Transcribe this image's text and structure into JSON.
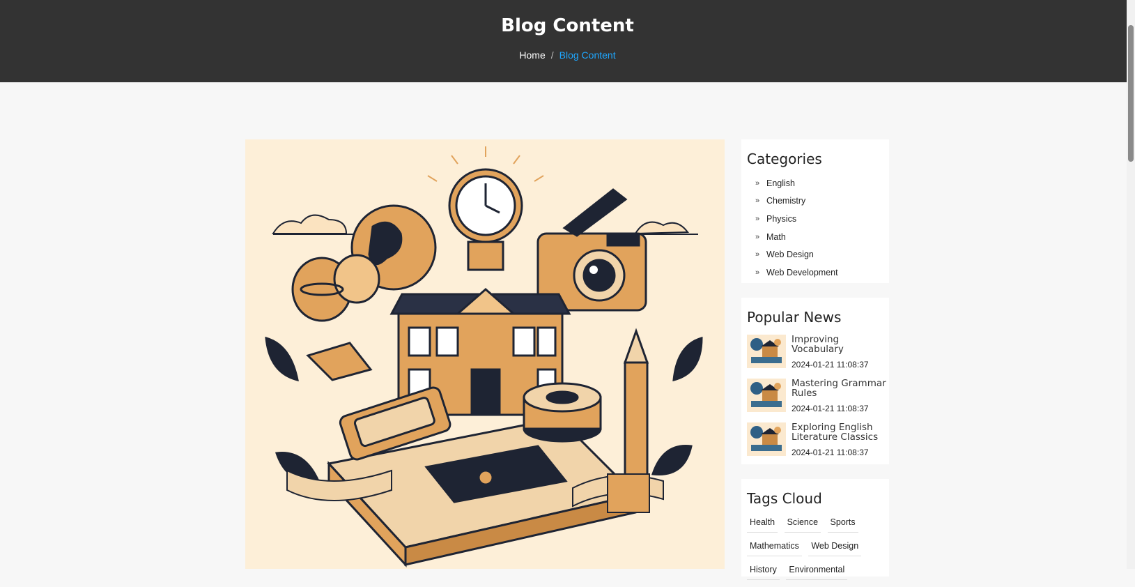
{
  "header": {
    "title": "Blog Content",
    "breadcrumb": {
      "home": "Home",
      "separator": "/",
      "current": "Blog Content"
    }
  },
  "feature_image": {
    "icon": "education-collage-illustration"
  },
  "sidebar": {
    "categories": {
      "title": "Categories",
      "items": [
        {
          "label": "English"
        },
        {
          "label": "Chemistry"
        },
        {
          "label": "Physics"
        },
        {
          "label": "Math"
        },
        {
          "label": "Web Design"
        },
        {
          "label": "Web Development"
        }
      ]
    },
    "popular_news": {
      "title": "Popular News",
      "items": [
        {
          "title": "Improving Vocabulary",
          "date": "2024-01-21 11:08:37"
        },
        {
          "title": "Mastering Grammar Rules",
          "date": "2024-01-21 11:08:37"
        },
        {
          "title": "Exploring English Literature Classics",
          "date": "2024-01-21 11:08:37"
        }
      ]
    },
    "tags": {
      "title": "Tags Cloud",
      "items": [
        "Health",
        "Science",
        "Sports",
        "Mathematics",
        "Web Design",
        "History",
        "Environmental"
      ]
    }
  },
  "colors": {
    "header_bg": "#333333",
    "breadcrumb_active": "#1ea7ff",
    "page_bg": "#f7f7f7",
    "illustration_bg": "#fdefd8",
    "illustration_orange": "#e1a35c",
    "illustration_navy": "#1e2433"
  }
}
